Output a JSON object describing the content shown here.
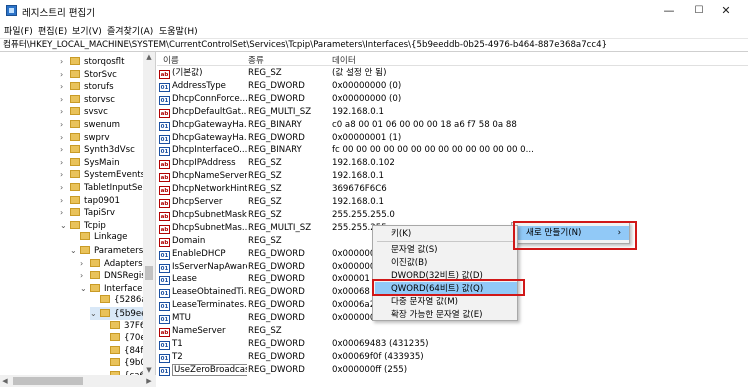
{
  "window": {
    "title": "레지스트리 편집기",
    "minimize": "—",
    "maximize": "☐",
    "close": "✕"
  },
  "menu": [
    "파일(F)",
    "편집(E)",
    "보기(V)",
    "즐겨찾기(A)",
    "도움말(H)"
  ],
  "address": "컴퓨터\\HKEY_LOCAL_MACHINE\\SYSTEM\\CurrentControlSet\\Services\\Tcpip\\Parameters\\Interfaces\\{5b9eeddb-0b25-4976-b464-887e368a7cc4}",
  "tree": [
    {
      "label": "storqosflt",
      "chev": "›"
    },
    {
      "label": "StorSvc",
      "chev": "›"
    },
    {
      "label": "storufs",
      "chev": "›"
    },
    {
      "label": "storvsc",
      "chev": "›"
    },
    {
      "label": "svsvc",
      "chev": "›"
    },
    {
      "label": "swenum",
      "chev": "›"
    },
    {
      "label": "swprv",
      "chev": "›"
    },
    {
      "label": "Synth3dVsc",
      "chev": "›"
    },
    {
      "label": "SysMain",
      "chev": "›"
    },
    {
      "label": "SystemEventsBr",
      "chev": "›"
    },
    {
      "label": "TabletInputServi",
      "chev": "›"
    },
    {
      "label": "tap0901",
      "chev": "›"
    },
    {
      "label": "TapiSrv",
      "chev": "›"
    },
    {
      "label": "Tcpip",
      "chev": "⌄"
    },
    {
      "label": "Linkage",
      "chev": ""
    },
    {
      "label": "Parameters",
      "chev": "⌄"
    },
    {
      "label": "Adapters",
      "chev": "›"
    },
    {
      "label": "DNSRegist",
      "chev": "›"
    },
    {
      "label": "Interfaces",
      "chev": "⌄"
    },
    {
      "label": "{5286a5",
      "chev": ""
    },
    {
      "label": "{5b9eec",
      "chev": "⌄"
    },
    {
      "label": "37F6I",
      "chev": ""
    },
    {
      "label": "{70e76b",
      "chev": ""
    },
    {
      "label": "{84f4ca",
      "chev": ""
    },
    {
      "label": "{9b0336",
      "chev": ""
    },
    {
      "label": "{ca6d6b",
      "chev": ""
    }
  ],
  "columns": {
    "name": "이름",
    "type": "종류",
    "data": "데이터"
  },
  "rows": [
    {
      "icon": "ab",
      "name": "(기본값)",
      "type": "REG_SZ",
      "data": "(값 설정 안 됨)"
    },
    {
      "icon": "bin",
      "name": "AddressType",
      "type": "REG_DWORD",
      "data": "0x00000000 (0)"
    },
    {
      "icon": "bin",
      "name": "DhcpConnForce...",
      "type": "REG_DWORD",
      "data": "0x00000000 (0)"
    },
    {
      "icon": "ab",
      "name": "DhcpDefaultGat...",
      "type": "REG_MULTI_SZ",
      "data": "192.168.0.1"
    },
    {
      "icon": "bin",
      "name": "DhcpGatewayHa...",
      "type": "REG_BINARY",
      "data": "c0 a8 00 01 06 00 00 00 18 a6 f7 58 0a 88"
    },
    {
      "icon": "bin",
      "name": "DhcpGatewayHa...",
      "type": "REG_DWORD",
      "data": "0x00000001 (1)"
    },
    {
      "icon": "bin",
      "name": "DhcpInterfaceO...",
      "type": "REG_BINARY",
      "data": "fc 00 00 00 00 00 00 00 00 00 00 00 00 00 0..."
    },
    {
      "icon": "ab",
      "name": "DhcpIPAddress",
      "type": "REG_SZ",
      "data": "192.168.0.102"
    },
    {
      "icon": "ab",
      "name": "DhcpNameServer",
      "type": "REG_SZ",
      "data": "192.168.0.1"
    },
    {
      "icon": "ab",
      "name": "DhcpNetworkHint",
      "type": "REG_SZ",
      "data": "369676F6C6"
    },
    {
      "icon": "ab",
      "name": "DhcpServer",
      "type": "REG_SZ",
      "data": "192.168.0.1"
    },
    {
      "icon": "ab",
      "name": "DhcpSubnetMask",
      "type": "REG_SZ",
      "data": "255.255.255.0"
    },
    {
      "icon": "ab",
      "name": "DhcpSubnetMas...",
      "type": "REG_MULTI_SZ",
      "data": "255.255.255"
    },
    {
      "icon": "ab",
      "name": "Domain",
      "type": "REG_SZ",
      "data": ""
    },
    {
      "icon": "bin",
      "name": "EnableDHCP",
      "type": "REG_DWORD",
      "data": "0x000000"
    },
    {
      "icon": "bin",
      "name": "IsServerNapAware",
      "type": "REG_DWORD",
      "data": "0x000000"
    },
    {
      "icon": "bin",
      "name": "Lease",
      "type": "REG_DWORD",
      "data": "0x00001"
    },
    {
      "icon": "bin",
      "name": "LeaseObtainedTi...",
      "type": "REG_DWORD",
      "data": "0x00068"
    },
    {
      "icon": "bin",
      "name": "LeaseTerminates...",
      "type": "REG_DWORD",
      "data": "0x0006a2"
    },
    {
      "icon": "bin",
      "name": "MTU",
      "type": "REG_DWORD",
      "data": "0x000000"
    },
    {
      "icon": "ab",
      "name": "NameServer",
      "type": "REG_SZ",
      "data": ""
    },
    {
      "icon": "bin",
      "name": "T1",
      "type": "REG_DWORD",
      "data": "0x00069483 (431235)"
    },
    {
      "icon": "bin",
      "name": "T2",
      "type": "REG_DWORD",
      "data": "0x00069f0f (433935)"
    },
    {
      "icon": "bin",
      "name": "UseZeroBroadcast",
      "type": "REG_DWORD",
      "data": "0x000000ff (255)"
    }
  ],
  "context_menu": {
    "new_label": "새로 만들기(N)",
    "new_arrow": "›"
  },
  "submenu": {
    "key": "키(K)",
    "string": "문자열 값(S)",
    "binary": "이진값(B)",
    "dword": "DWORD(32비트) 값(D)",
    "qword": "QWORD(64비트) 값(Q)",
    "multi": "다중 문자열 값(M)",
    "expand": "확장 가능한 문자열 값(E)"
  },
  "colors": {
    "highlight": "#91c9f7",
    "annotation": "#d01818"
  }
}
